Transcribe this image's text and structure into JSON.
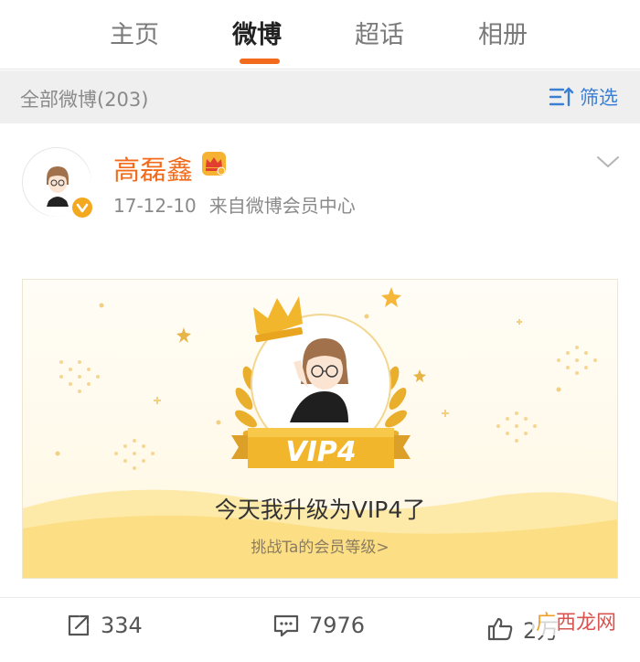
{
  "tabs": [
    {
      "label": "主页",
      "active": false
    },
    {
      "label": "微博",
      "active": true
    },
    {
      "label": "超话",
      "active": false
    },
    {
      "label": "相册",
      "active": false
    }
  ],
  "filter_bar": {
    "count_label": "全部微博(203)",
    "filter_label": "筛选",
    "filter_icon": "filter-icon"
  },
  "post": {
    "username": "高磊鑫",
    "user_badge_icon": "vip-crown-badge-icon",
    "verified_icon": "verified-v-icon",
    "date": "17-12-10",
    "source": "来自微博会员中心",
    "menu_icon": "chevron-down-icon",
    "card": {
      "ribbon_text": "VIP4",
      "title": "今天我升级为VIP4了",
      "subtitle": "挑战Ta的会员等级>"
    },
    "actions": {
      "repost_count": "334",
      "comment_count": "7976",
      "like_count": "2万"
    }
  },
  "watermark": {
    "part1": "广",
    "part2": "西龙网"
  },
  "colors": {
    "accent_orange": "#f26b1c",
    "link_blue": "#3b7fd4",
    "gold": "#f2b12b",
    "bar_gray": "#efefef"
  }
}
